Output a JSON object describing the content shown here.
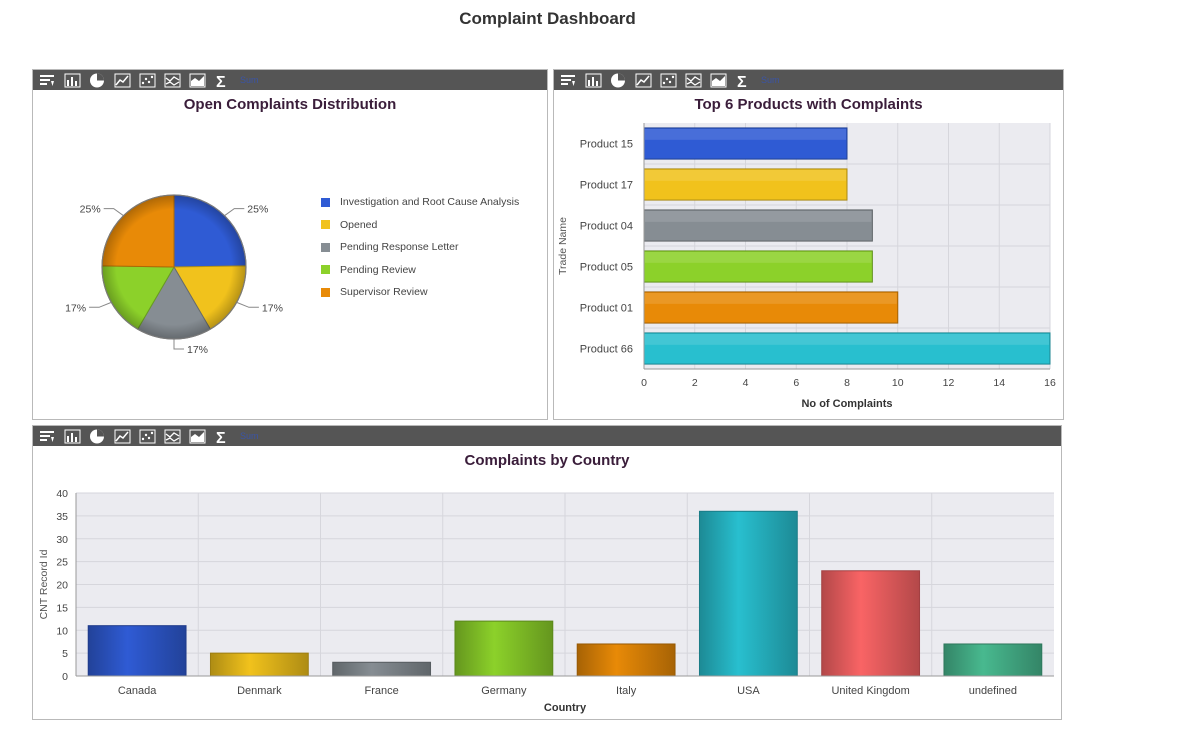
{
  "page": {
    "title": "Complaint Dashboard"
  },
  "toolbar": {
    "sum_label": "Sum",
    "icons": [
      "filter-icon",
      "bar-chart-icon",
      "pie-chart-icon",
      "line-chart-icon",
      "scatter-chart-icon",
      "multi-line-chart-icon",
      "area-chart-icon",
      "sigma-icon"
    ]
  },
  "colors": {
    "toolbar": "#555555",
    "plot_bg": "#ebebf0",
    "blue": "#2f5bd4",
    "yellow": "#f1c21c",
    "gray": "#868d93",
    "green": "#8cd12a",
    "orange": "#e88a07",
    "cyan": "#28bfcf",
    "red": "#f96465",
    "teal": "#48b98f"
  },
  "chart_data": [
    {
      "type": "pie",
      "title": "Open Complaints Distribution",
      "labels": [
        "Investigation and Root Cause Analysis",
        "Opened",
        "Pending Response Letter",
        "Pending Review",
        "Supervisor Review"
      ],
      "values": [
        25,
        17,
        17,
        17,
        25
      ],
      "value_labels": [
        "25%",
        "17%",
        "17%",
        "17%",
        "25%"
      ],
      "colors": [
        "#2f5bd4",
        "#f1c21c",
        "#868d93",
        "#8cd12a",
        "#e88a07"
      ],
      "legend": "right"
    },
    {
      "type": "bar",
      "orientation": "horizontal",
      "title": "Top 6 Products with Complaints",
      "categories": [
        "Product 15",
        "Product 17",
        "Product 04",
        "Product 05",
        "Product 01",
        "Product 66"
      ],
      "values": [
        8,
        8,
        9,
        9,
        10,
        16
      ],
      "colors": [
        "#2f5bd4",
        "#f1c21c",
        "#868d93",
        "#8cd12a",
        "#e88a07",
        "#28bfcf"
      ],
      "xlabel": "No of Complaints",
      "ylabel": "Trade Name",
      "xlim": [
        0,
        16
      ],
      "xticks": [
        0,
        2,
        4,
        6,
        8,
        10,
        12,
        14,
        16
      ],
      "grid": true
    },
    {
      "type": "bar",
      "title": "Complaints by Country",
      "categories": [
        "Canada",
        "Denmark",
        "France",
        "Germany",
        "Italy",
        "USA",
        "United Kingdom",
        "undefined"
      ],
      "values": [
        11,
        5,
        3,
        12,
        7,
        36,
        23,
        7
      ],
      "colors": [
        "#2f5bd4",
        "#f1c21c",
        "#868d93",
        "#8cd12a",
        "#e88a07",
        "#28bfcf",
        "#f96465",
        "#48b98f"
      ],
      "xlabel": "Country",
      "ylabel": "CNT Record Id",
      "ylim": [
        0,
        40
      ],
      "yticks": [
        0,
        5,
        10,
        15,
        20,
        25,
        30,
        35,
        40
      ],
      "grid": true
    }
  ]
}
